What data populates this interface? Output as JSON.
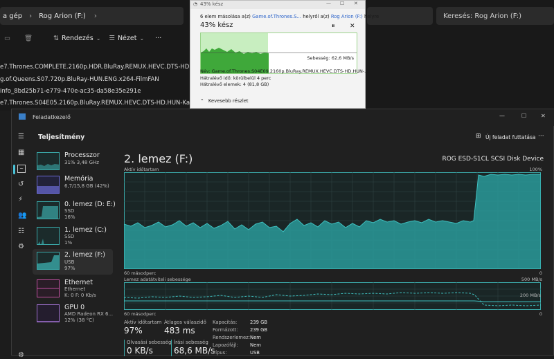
{
  "explorer": {
    "address": [
      "a gép",
      "Rog Arion (F:)"
    ],
    "search_placeholder": "Keresés: Rog Arion (F:)",
    "toolbar": {
      "sort_label": "Rendezés",
      "view_label": "Nézet",
      "more_label": "···"
    },
    "files": [
      "e7.Thrones.COMPLETE.2160p.HDR.BluRay.REMUX.HEVC.DTS-HD.HUN-Kataklysm",
      "g.of.Queens.S07.720p.BluRay-HUN.ENG.x264-FilmFAN",
      "info_8bd25b71-e779-470e-ac35-da58e35e291e",
      "e7.Thrones.S04E05.2160p.BluRay.REMUX.HEVC.DTS-HD.HUN-Kataklysm"
    ]
  },
  "copy_dialog": {
    "title": "43% kész",
    "line_prefix": "6 elem másolása a(z)",
    "source": "Game.of.Thrones.S...",
    "line_mid": "helyről a(z)",
    "dest": "Rog Arion (F:)",
    "line_suffix": "helyre",
    "percent": "43% kész",
    "progress": 0.43,
    "speed": "Sebesség: 62,6 MB/s",
    "name_line": "Név: Game.of.Thrones.S04E09.2160p.BluRay.REMUX.HEVC.DTS-HD.HUN-...",
    "time_left": "Hátralévő idő:  körülbelül 4 perc",
    "items_left": "Hátralévő elemek: 4 (81,8 GB)",
    "less_details": "Kevesebb részlet",
    "pause_glyph": "⏸",
    "close_glyph": "✕"
  },
  "taskmgr": {
    "title": "Feladatkezelő",
    "section": "Teljesítmény",
    "new_task": "Új feladat futtatása",
    "more": "···",
    "window_controls": [
      "—",
      "☐",
      "✕"
    ],
    "list": [
      {
        "name": "Processzor",
        "sub1": "31% 3,48 GHz",
        "sub2": "",
        "sub3": "",
        "color": "#3aa8a8"
      },
      {
        "name": "Memória",
        "sub1": "6,7/15,8 GB (42%)",
        "sub2": "",
        "sub3": "",
        "color": "#6b6bd6"
      },
      {
        "name": "0. lemez (D: E:)",
        "sub1": "SSD",
        "sub2": "16%",
        "sub3": "",
        "color": "#3aa8a8"
      },
      {
        "name": "1. lemez (C:)",
        "sub1": "SSD",
        "sub2": "1%",
        "sub3": "",
        "color": "#3aa8a8"
      },
      {
        "name": "2. lemez (F:)",
        "sub1": "USB",
        "sub2": "97%",
        "sub3": "",
        "color": "#3aa8a8"
      },
      {
        "name": "Ethernet",
        "sub1": "Ethernet",
        "sub2": "K: 0 F: 0 Kb/s",
        "sub3": "",
        "color": "#c050a0"
      },
      {
        "name": "GPU 0",
        "sub1": "AMD Radeon RX 6...",
        "sub2": "12% (38 °C)",
        "sub3": "",
        "color": "#a070d0"
      }
    ],
    "main": {
      "title": "2. lemez (F:)",
      "device": "ROG ESD-S1CL SCSI Disk Device",
      "graph1_label": "Aktív időtartam",
      "graph1_max": "100%",
      "graph1_left": "60 másodperc",
      "graph1_right": "0",
      "graph2_label": "Lemez adatátviteli sebessége",
      "graph2_max": "500 MB/s",
      "graph2_mid": "200 MB/s",
      "graph2_left": "60 másodperc",
      "graph2_right": "0",
      "active_time_label": "Aktív időtartam",
      "active_time": "97%",
      "avg_resp_label": "Átlagos válaszidő",
      "avg_resp": "483 ms",
      "read_label": "Olvasási sebesség",
      "read": "0 KB/s",
      "write_label": "Írási sebesség",
      "write": "68,6 MB/s",
      "props": [
        {
          "label": "Kapacitás:",
          "value": "239 GB"
        },
        {
          "label": "Formázott:",
          "value": "239 GB"
        },
        {
          "label": "Rendszerlemez:",
          "value": "Nem"
        },
        {
          "label": "Lapozófájl:",
          "value": "Nem"
        },
        {
          "label": "Típus:",
          "value": "USB"
        }
      ]
    }
  }
}
